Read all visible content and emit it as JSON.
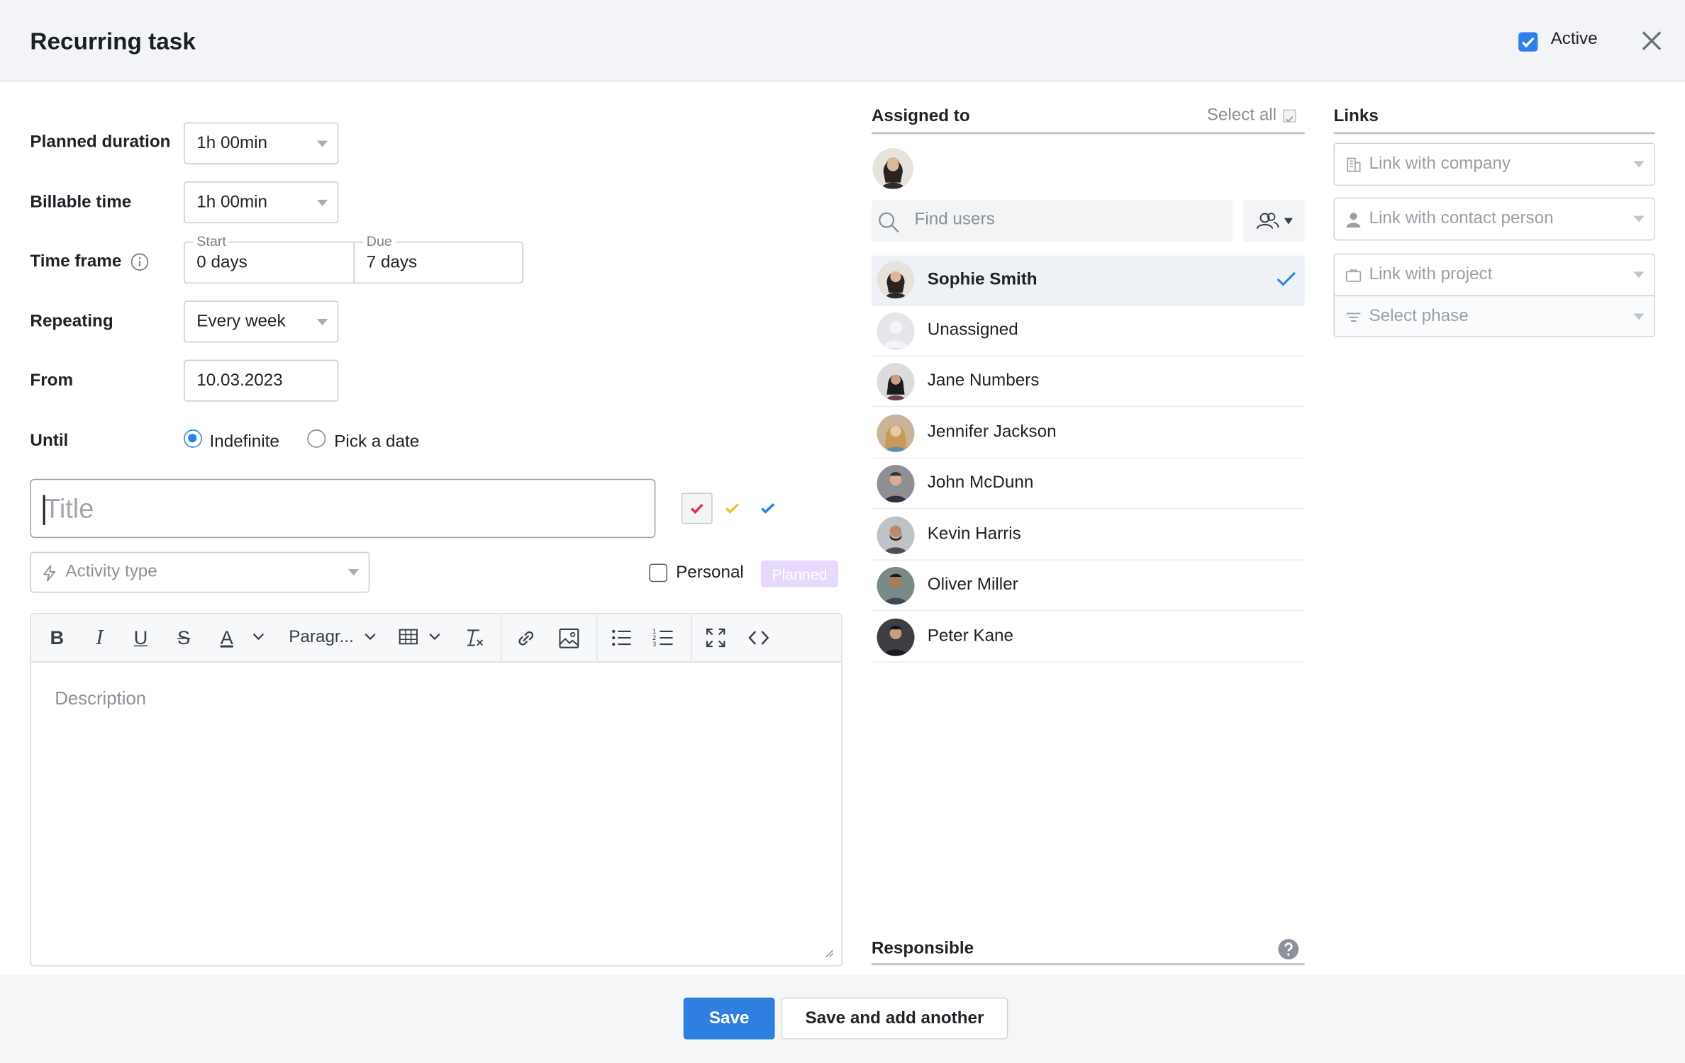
{
  "header": {
    "title": "Recurring task",
    "active_label": "Active",
    "active_checked": true
  },
  "form": {
    "planned_duration": {
      "label": "Planned duration",
      "value": "1h 00min"
    },
    "billable_time": {
      "label": "Billable time",
      "value": "1h 00min"
    },
    "time_frame": {
      "label": "Time frame",
      "start_label": "Start",
      "start_value": "0 days",
      "due_label": "Due",
      "due_value": "7 days"
    },
    "repeating": {
      "label": "Repeating",
      "value": "Every week"
    },
    "from": {
      "label": "From",
      "value": "10.03.2023"
    },
    "until": {
      "label": "Until",
      "option_indefinite": "Indefinite",
      "option_pick": "Pick a date",
      "selected": "Indefinite"
    },
    "title_placeholder": "Title",
    "activity_type_placeholder": "Activity type",
    "personal_label": "Personal",
    "planned_badge": "Planned",
    "paragraph_label": "Paragr...",
    "description_placeholder": "Description"
  },
  "colors": {
    "accent": "#2f80ed",
    "check_red": "#e0314f",
    "check_yellow": "#f2c230",
    "check_blue": "#2f7fe0",
    "planned_badge_bg": "#e6d9fb"
  },
  "assigned": {
    "heading": "Assigned to",
    "select_all": "Select all",
    "search_placeholder": "Find users",
    "users": [
      {
        "name": "Sophie Smith",
        "selected": true
      },
      {
        "name": "Unassigned",
        "selected": false
      },
      {
        "name": "Jane Numbers",
        "selected": false
      },
      {
        "name": "Jennifer Jackson",
        "selected": false
      },
      {
        "name": "John McDunn",
        "selected": false
      },
      {
        "name": "Kevin Harris",
        "selected": false
      },
      {
        "name": "Oliver Miller",
        "selected": false
      },
      {
        "name": "Peter Kane",
        "selected": false
      }
    ],
    "responsible_heading": "Responsible"
  },
  "links": {
    "heading": "Links",
    "company_placeholder": "Link with company",
    "contact_placeholder": "Link with contact person",
    "project_placeholder": "Link with project",
    "phase_placeholder": "Select phase"
  },
  "footer": {
    "save_label": "Save",
    "save_another_label": "Save and add another"
  }
}
